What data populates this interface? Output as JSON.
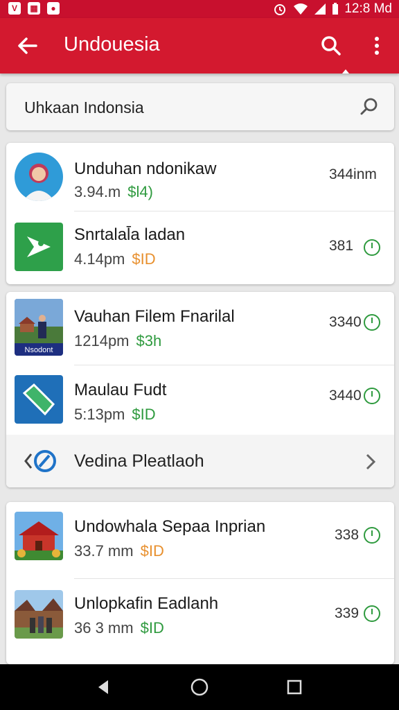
{
  "status_bar": {
    "left_icons": [
      "shield-icon",
      "image-icon",
      "chat-icon"
    ],
    "clock": "12:8 Md"
  },
  "app_bar": {
    "title": "Undouesia",
    "icons": [
      "back-arrow-icon",
      "search-icon",
      "more-vert-icon"
    ]
  },
  "search": {
    "value": "Uhkaan Indonsia",
    "icon": "search-icon"
  },
  "cards": [
    {
      "items": [
        {
          "title": "Unduhan ndonikaw",
          "time": "3.94.m",
          "price": "$l4)",
          "price_color": "#2e9a3e",
          "right": "344inm",
          "has_clock": false,
          "thumb": "person-avatar"
        },
        {
          "title": "Snrtalal̄a ladan",
          "time": "4.14pm",
          "price": "$ID",
          "price_color": "#e8902e",
          "right": "381",
          "has_clock": true,
          "thumb": "green-app-logo"
        }
      ]
    },
    {
      "items": [
        {
          "title": "Vauhan Filem Fnarilal",
          "time": "1214pm",
          "price": "$3h",
          "price_color": "#2e9a3e",
          "right": "3340",
          "has_clock": true,
          "thumb": "film-poster",
          "thumb_caption": "Nsodont"
        },
        {
          "title": "Maulau Fudt",
          "time": "5:13pm",
          "price": "$ID",
          "price_color": "#2e9a3e",
          "right": "3440",
          "has_clock": true,
          "thumb": "blue-app-logo"
        }
      ],
      "footer": {
        "label": "Vedina Pleatlaoh",
        "left_icon": "compass-icon",
        "right_icon": "chevron-right-icon"
      }
    },
    {
      "items": [
        {
          "title": "Undowhala Sepaa Inprian",
          "time": "33.7 mm",
          "price": "$ID",
          "price_color": "#e8902e",
          "right": "338",
          "has_clock": true,
          "thumb": "red-house-photo"
        },
        {
          "title": "Unlopkafin Eadlanh",
          "time": "36 3 mm",
          "price": "$ID",
          "price_color": "#2e9a3e",
          "right": "339",
          "has_clock": true,
          "thumb": "village-photo"
        }
      ]
    }
  ],
  "nav_bar": {
    "icons": [
      "back-triangle-icon",
      "home-circle-icon",
      "recents-square-icon"
    ]
  }
}
